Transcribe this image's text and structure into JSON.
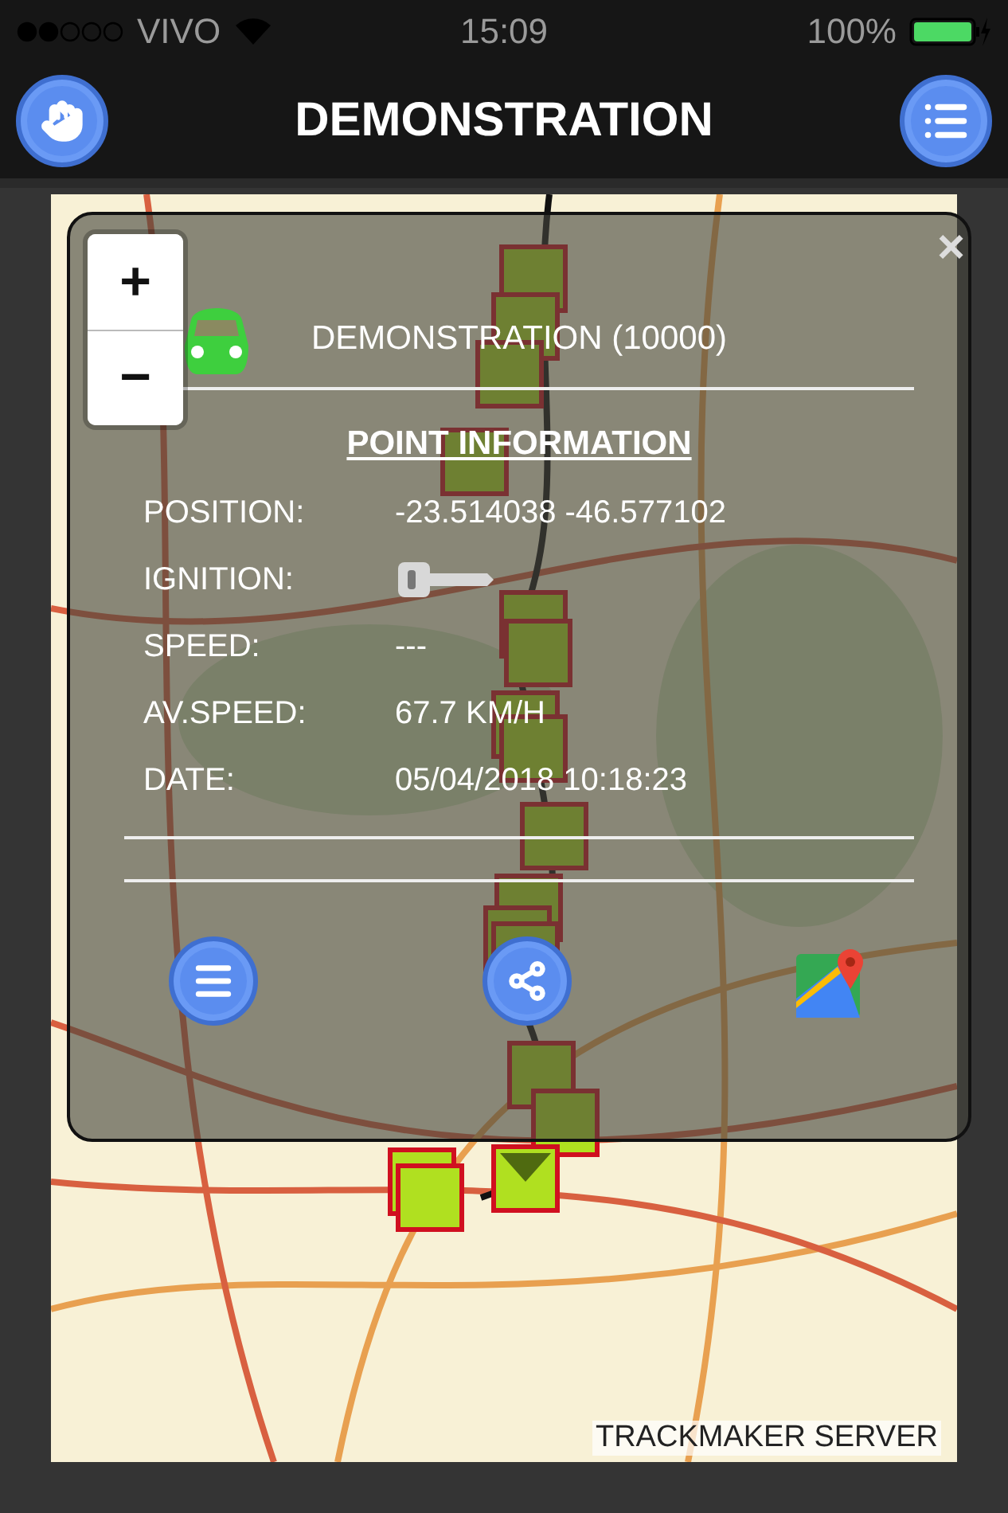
{
  "status_bar": {
    "carrier": "VIVO",
    "time": "15:09",
    "battery": "100%"
  },
  "header": {
    "title": "DEMONSTRATION"
  },
  "map": {
    "attribution": "TRACKMAKER SERVER"
  },
  "zoom": {
    "in": "+",
    "out": "−"
  },
  "popup": {
    "close": "×",
    "vehicle": "DEMONSTRATION (10000)",
    "section_title": "POINT INFORMATION",
    "fields": [
      {
        "kind": "text",
        "label": "POSITION:",
        "value": "-23.514038 -46.577102"
      },
      {
        "kind": "ignition",
        "label": "IGNITION:",
        "on": false
      },
      {
        "kind": "text",
        "label": "SPEED:",
        "value": "---"
      },
      {
        "kind": "text",
        "label": "AV.SPEED:",
        "value": "67.7 KM/H"
      },
      {
        "kind": "text",
        "label": "DATE:",
        "value": "05/04/2018 10:18:23"
      }
    ]
  }
}
